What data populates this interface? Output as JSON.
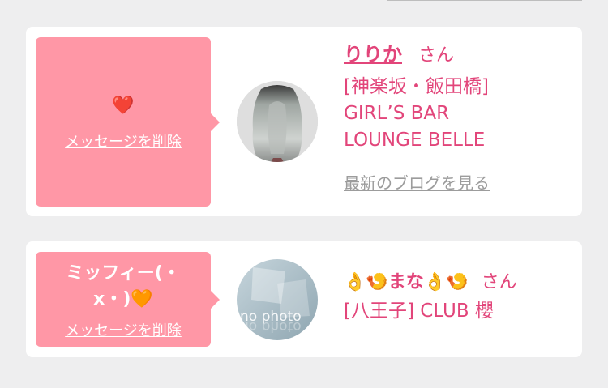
{
  "favorites": [
    {
      "message": "❤️",
      "delete_label": "メッセージを削除",
      "name": "りりか",
      "honorific": "さん",
      "shop": "[神楽坂・飯田橋] GIRL’S BAR LOUNGE BELLE",
      "blog_link": "最新のブログを見る",
      "avatar_icon": "avatar-photo"
    },
    {
      "message_line1": "ミッフィー(・",
      "message_line2": "x・)🧡",
      "delete_label": "メッセージを削除",
      "name": "👌🍤まな👌🍤",
      "honorific": "さん",
      "shop": "[八王子] CLUB 櫻",
      "avatar_text": "no photo",
      "avatar_icon": "no-photo-placeholder"
    }
  ],
  "colors": {
    "accent": "#e2457a",
    "bubble": "#ff97a6",
    "link_gray": "#9c9c9c"
  }
}
